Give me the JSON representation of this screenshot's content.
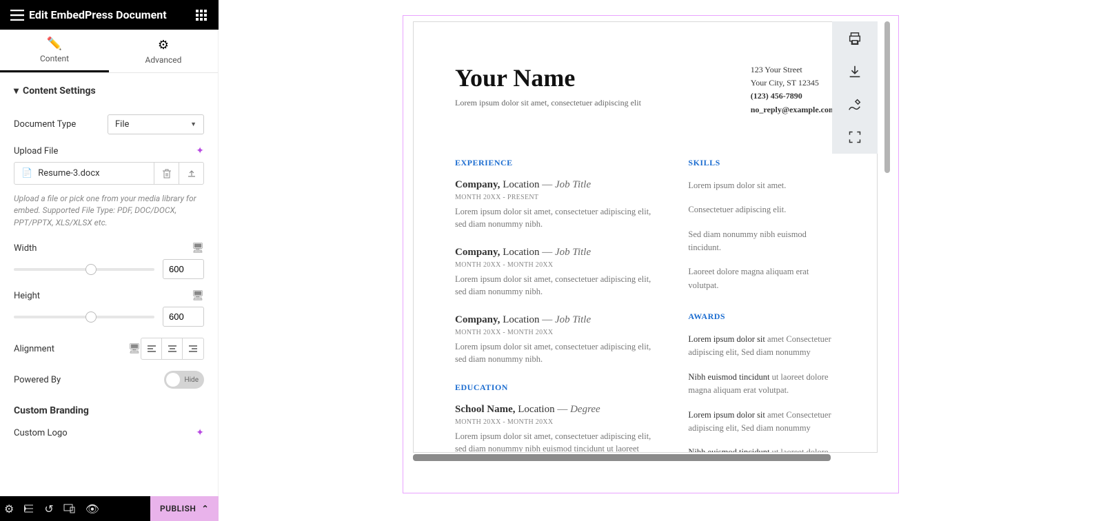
{
  "header": {
    "title": "Edit EmbedPress Document"
  },
  "tabs": {
    "content": "Content",
    "advanced": "Advanced"
  },
  "section": {
    "title": "Content Settings"
  },
  "doc_type": {
    "label": "Document Type",
    "value": "File"
  },
  "upload": {
    "label": "Upload File",
    "filename": "Resume-3.docx"
  },
  "help": "Upload a file or pick one from your media library for embed. Supported File Type: PDF, DOC/DOCX, PPT/PPTX, XLS/XLSX etc.",
  "width": {
    "label": "Width",
    "value": "600"
  },
  "height": {
    "label": "Height",
    "value": "600"
  },
  "alignment": {
    "label": "Alignment"
  },
  "powered": {
    "label": "Powered By",
    "state": "Hide"
  },
  "branding": {
    "title": "Custom Branding",
    "logo_label": "Custom Logo"
  },
  "publish": "PUBLISH",
  "resume": {
    "name": "Your Name",
    "tagline": "Lorem ipsum dolor sit amet, consectetuer adipiscing elit",
    "contact": {
      "street": "123 Your Street",
      "city": "Your City, ST 12345",
      "phone": "(123) 456-7890",
      "email": "no_reply@example.com"
    },
    "experience_title": "EXPERIENCE",
    "education_title": "EDUCATION",
    "skills_title": "SKILLS",
    "awards_title": "AWARDS",
    "exp": [
      {
        "company": "Company,",
        "location": "Location",
        "role": "Job Title",
        "dates": "MONTH 20XX - PRESENT",
        "body": "Lorem ipsum dolor sit amet, consectetuer adipiscing elit, sed diam nonummy nibh."
      },
      {
        "company": "Company,",
        "location": "Location",
        "role": "Job Title",
        "dates": "MONTH 20XX - MONTH 20XX",
        "body": "Lorem ipsum dolor sit amet, consectetuer adipiscing elit, sed diam nonummy nibh."
      },
      {
        "company": "Company,",
        "location": "Location",
        "role": "Job Title",
        "dates": "MONTH 20XX - MONTH 20XX",
        "body": "Lorem ipsum dolor sit amet, consectetuer adipiscing elit, sed diam nonummy nibh."
      }
    ],
    "edu": {
      "school": "School Name,",
      "location": "Location",
      "degree": "Degree",
      "dates": "MONTH 20XX - MONTH 20XX",
      "body": "Lorem ipsum dolor sit amet, consectetuer adipiscing elit, sed diam nonummy nibh euismod tincidunt ut laoreet dolore."
    },
    "skills": [
      "Lorem ipsum dolor sit amet.",
      "Consectetuer adipiscing elit.",
      "Sed diam nonummy nibh euismod tincidunt.",
      "Laoreet dolore magna aliquam erat volutpat."
    ],
    "awards": [
      {
        "lead": "Lorem ipsum dolor sit",
        "rest": " amet Consectetuer adipiscing elit, Sed diam nonummy"
      },
      {
        "lead": "Nibh euismod tincidunt",
        "rest": " ut laoreet dolore magna aliquam erat volutpat."
      },
      {
        "lead": "Lorem ipsum dolor sit",
        "rest": " amet Consectetuer adipiscing elit, Sed diam nonummy"
      },
      {
        "lead": "Nibh euismod tincidunt",
        "rest": " ut laoreet dolore magna aliquam"
      }
    ]
  }
}
